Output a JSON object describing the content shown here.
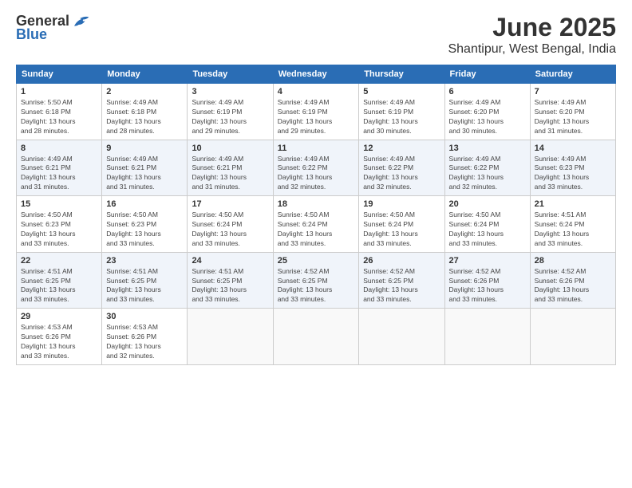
{
  "header": {
    "logo_general": "General",
    "logo_blue": "Blue",
    "title": "June 2025",
    "subtitle": "Shantipur, West Bengal, India"
  },
  "calendar": {
    "days_of_week": [
      "Sunday",
      "Monday",
      "Tuesday",
      "Wednesday",
      "Thursday",
      "Friday",
      "Saturday"
    ],
    "weeks": [
      [
        {
          "day": "1",
          "sunrise": "5:50 AM",
          "sunset": "6:18 PM",
          "daylight": "13 hours and 28 minutes."
        },
        {
          "day": "2",
          "sunrise": "4:49 AM",
          "sunset": "6:18 PM",
          "daylight": "13 hours and 28 minutes."
        },
        {
          "day": "3",
          "sunrise": "4:49 AM",
          "sunset": "6:19 PM",
          "daylight": "13 hours and 29 minutes."
        },
        {
          "day": "4",
          "sunrise": "4:49 AM",
          "sunset": "6:19 PM",
          "daylight": "13 hours and 29 minutes."
        },
        {
          "day": "5",
          "sunrise": "4:49 AM",
          "sunset": "6:19 PM",
          "daylight": "13 hours and 30 minutes."
        },
        {
          "day": "6",
          "sunrise": "4:49 AM",
          "sunset": "6:20 PM",
          "daylight": "13 hours and 30 minutes."
        },
        {
          "day": "7",
          "sunrise": "4:49 AM",
          "sunset": "6:20 PM",
          "daylight": "13 hours and 31 minutes."
        }
      ],
      [
        {
          "day": "8",
          "sunrise": "4:49 AM",
          "sunset": "6:21 PM",
          "daylight": "13 hours and 31 minutes."
        },
        {
          "day": "9",
          "sunrise": "4:49 AM",
          "sunset": "6:21 PM",
          "daylight": "13 hours and 31 minutes."
        },
        {
          "day": "10",
          "sunrise": "4:49 AM",
          "sunset": "6:21 PM",
          "daylight": "13 hours and 31 minutes."
        },
        {
          "day": "11",
          "sunrise": "4:49 AM",
          "sunset": "6:22 PM",
          "daylight": "13 hours and 32 minutes."
        },
        {
          "day": "12",
          "sunrise": "4:49 AM",
          "sunset": "6:22 PM",
          "daylight": "13 hours and 32 minutes."
        },
        {
          "day": "13",
          "sunrise": "4:49 AM",
          "sunset": "6:22 PM",
          "daylight": "13 hours and 32 minutes."
        },
        {
          "day": "14",
          "sunrise": "4:49 AM",
          "sunset": "6:23 PM",
          "daylight": "13 hours and 33 minutes."
        }
      ],
      [
        {
          "day": "15",
          "sunrise": "4:50 AM",
          "sunset": "6:23 PM",
          "daylight": "13 hours and 33 minutes."
        },
        {
          "day": "16",
          "sunrise": "4:50 AM",
          "sunset": "6:23 PM",
          "daylight": "13 hours and 33 minutes."
        },
        {
          "day": "17",
          "sunrise": "4:50 AM",
          "sunset": "6:24 PM",
          "daylight": "13 hours and 33 minutes."
        },
        {
          "day": "18",
          "sunrise": "4:50 AM",
          "sunset": "6:24 PM",
          "daylight": "13 hours and 33 minutes."
        },
        {
          "day": "19",
          "sunrise": "4:50 AM",
          "sunset": "6:24 PM",
          "daylight": "13 hours and 33 minutes."
        },
        {
          "day": "20",
          "sunrise": "4:50 AM",
          "sunset": "6:24 PM",
          "daylight": "13 hours and 33 minutes."
        },
        {
          "day": "21",
          "sunrise": "4:51 AM",
          "sunset": "6:24 PM",
          "daylight": "13 hours and 33 minutes."
        }
      ],
      [
        {
          "day": "22",
          "sunrise": "4:51 AM",
          "sunset": "6:25 PM",
          "daylight": "13 hours and 33 minutes."
        },
        {
          "day": "23",
          "sunrise": "4:51 AM",
          "sunset": "6:25 PM",
          "daylight": "13 hours and 33 minutes."
        },
        {
          "day": "24",
          "sunrise": "4:51 AM",
          "sunset": "6:25 PM",
          "daylight": "13 hours and 33 minutes."
        },
        {
          "day": "25",
          "sunrise": "4:52 AM",
          "sunset": "6:25 PM",
          "daylight": "13 hours and 33 minutes."
        },
        {
          "day": "26",
          "sunrise": "4:52 AM",
          "sunset": "6:25 PM",
          "daylight": "13 hours and 33 minutes."
        },
        {
          "day": "27",
          "sunrise": "4:52 AM",
          "sunset": "6:26 PM",
          "daylight": "13 hours and 33 minutes."
        },
        {
          "day": "28",
          "sunrise": "4:52 AM",
          "sunset": "6:26 PM",
          "daylight": "13 hours and 33 minutes."
        }
      ],
      [
        {
          "day": "29",
          "sunrise": "4:53 AM",
          "sunset": "6:26 PM",
          "daylight": "13 hours and 33 minutes."
        },
        {
          "day": "30",
          "sunrise": "4:53 AM",
          "sunset": "6:26 PM",
          "daylight": "13 hours and 32 minutes."
        },
        null,
        null,
        null,
        null,
        null
      ]
    ]
  }
}
